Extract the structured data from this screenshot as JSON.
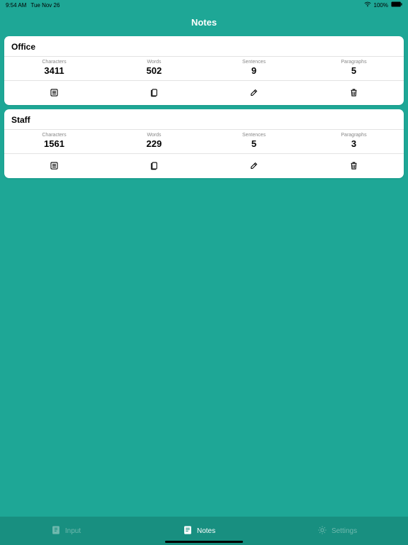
{
  "status": {
    "time": "9:54 AM",
    "date": "Tue Nov 26",
    "battery": "100%"
  },
  "header": {
    "title": "Notes"
  },
  "notes": [
    {
      "title": "Office",
      "labels": {
        "characters": "Characters",
        "words": "Words",
        "sentences": "Sentences",
        "paragraphs": "Paragraphs"
      },
      "values": {
        "characters": "3411",
        "words": "502",
        "sentences": "9",
        "paragraphs": "5"
      }
    },
    {
      "title": "Staff",
      "labels": {
        "characters": "Characters",
        "words": "Words",
        "sentences": "Sentences",
        "paragraphs": "Paragraphs"
      },
      "values": {
        "characters": "1561",
        "words": "229",
        "sentences": "5",
        "paragraphs": "3"
      }
    }
  ],
  "tabs": {
    "input": "Input",
    "notes": "Notes",
    "settings": "Settings"
  }
}
